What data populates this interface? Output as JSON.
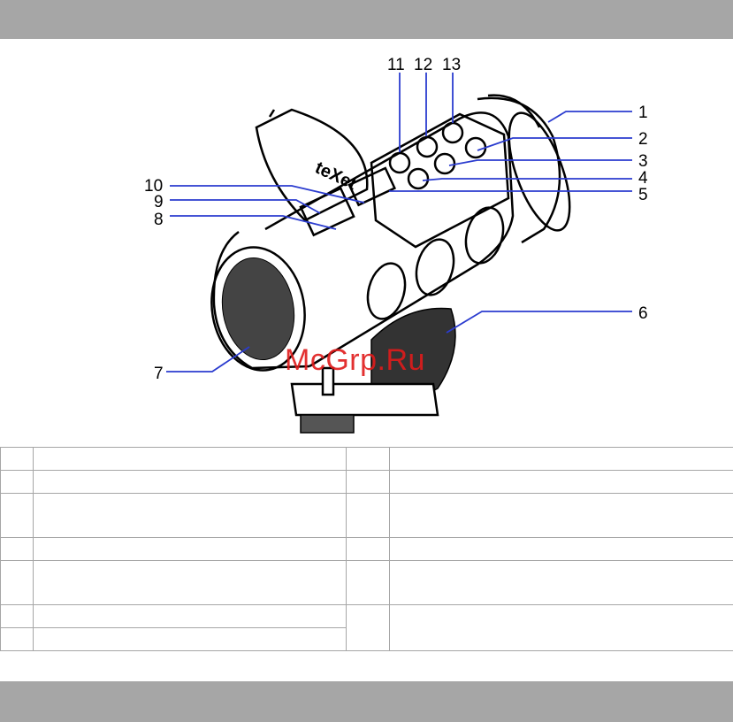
{
  "watermark": "McGrp.Ru",
  "callouts": [
    "1",
    "2",
    "3",
    "4",
    "5",
    "6",
    "7",
    "8",
    "9",
    "10",
    "11",
    "12",
    "13"
  ],
  "device_logo": "teXet",
  "parts_table": {
    "rows": [
      {
        "left_num": "",
        "left_desc": "",
        "right_num": "",
        "right_desc": ""
      },
      {
        "left_num": "",
        "left_desc": "",
        "right_num": "",
        "right_desc": ""
      },
      {
        "left_num": "",
        "left_desc": "",
        "right_num": "",
        "right_desc": ""
      },
      {
        "left_num": "",
        "left_desc": "",
        "right_num": "",
        "right_desc": ""
      },
      {
        "left_num": "",
        "left_desc": "",
        "right_num": "",
        "right_desc": ""
      },
      {
        "left_num": "",
        "left_desc": "",
        "right_num": "",
        "right_desc": ""
      },
      {
        "left_num": "",
        "left_desc": ""
      }
    ]
  },
  "colors": {
    "header_bar": "#a6a6a6",
    "callout_line": "#2b3ccf",
    "watermark": "#e01b1b"
  }
}
